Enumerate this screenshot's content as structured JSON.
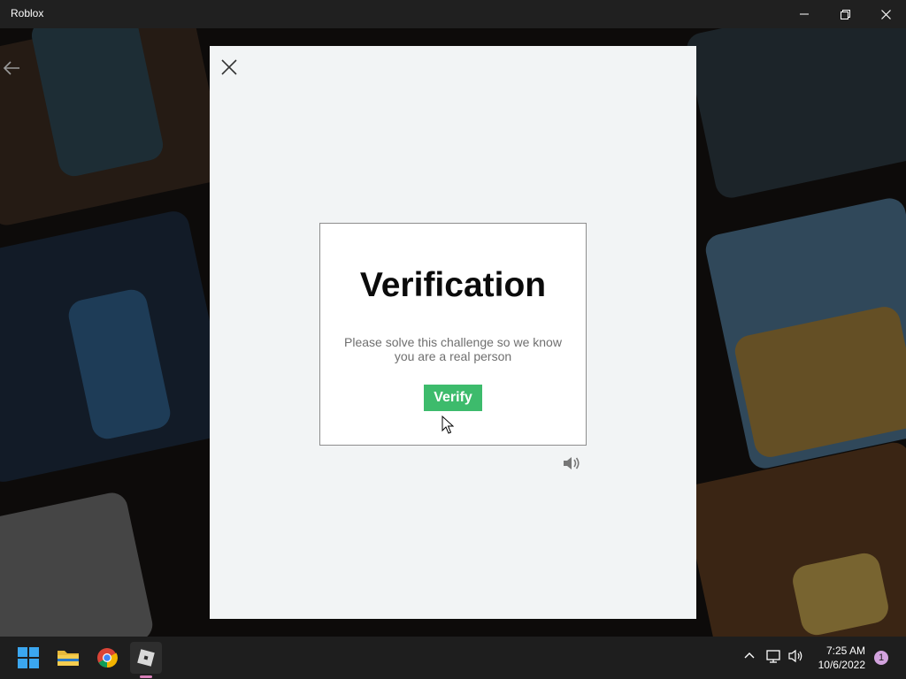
{
  "window": {
    "title": "Roblox",
    "minimize_icon": "minimize-icon",
    "restore_icon": "restore-icon",
    "close_icon": "close-icon"
  },
  "app": {
    "back_icon": "back-arrow-icon"
  },
  "modal": {
    "close_icon": "close-icon",
    "heading": "Verification",
    "message": "Please solve this challenge so we know you are a real person",
    "verify_label": "Verify",
    "audio_icon": "speaker-icon",
    "accent": "#3dbb6c"
  },
  "taskbar": {
    "apps": [
      {
        "name": "Start",
        "icon": "windows-start-icon"
      },
      {
        "name": "File Explorer",
        "icon": "folder-icon"
      },
      {
        "name": "Google Chrome",
        "icon": "chrome-icon"
      },
      {
        "name": "Roblox",
        "icon": "roblox-icon",
        "active": true
      }
    ],
    "tray": {
      "overflow_icon": "chevron-up-icon",
      "network_icon": "network-icon",
      "volume_icon": "volume-icon",
      "time": "7:25 AM",
      "date": "10/6/2022",
      "notification_count": "1"
    }
  }
}
